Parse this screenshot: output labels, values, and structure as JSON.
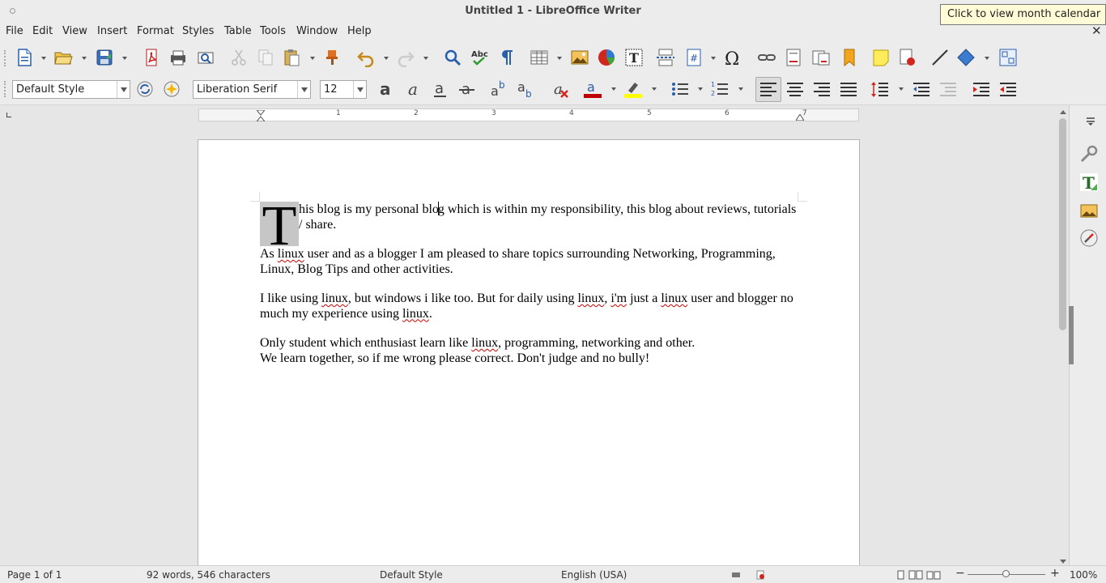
{
  "window": {
    "title": "Untitled 1 - LibreOffice Writer",
    "tooltip": "Click to view month calendar"
  },
  "menu": [
    "File",
    "Edit",
    "View",
    "Insert",
    "Format",
    "Styles",
    "Table",
    "Tools",
    "Window",
    "Help"
  ],
  "formatting": {
    "paragraph_style": "Default Style",
    "font_name": "Liberation Serif",
    "font_size": "12"
  },
  "ruler": {
    "numbers": [
      "1",
      "2",
      "3",
      "4",
      "5",
      "6",
      "7"
    ]
  },
  "document": {
    "dropcap": "T",
    "p1_a": "his blog is my personal blo",
    "p1_b": "g which is within my responsibility, this blog about reviews, tutorials / share.",
    "p2_a": "As ",
    "p2_linux": "linux",
    "p2_b": " user and as a blogger I am pleased to share topics surrounding Networking, Programming, Linux, Blog Tips and other activities.",
    "p3_a": "I like using ",
    "p3_linux1": "linux",
    "p3_b": ", but windows i like too. But for daily using ",
    "p3_linux2": "linux",
    "p3_c": ", ",
    "p3_im": "i'm",
    "p3_d": " just a ",
    "p3_linux3": "linux",
    "p3_e": " user and blogger no much my experience using ",
    "p3_linux4": "linux",
    "p3_f": ".",
    "p4_a": "Only student which enthusiast learn like ",
    "p4_linux": "linux",
    "p4_b": ", programming, networking and other.",
    "p4_line2": "We learn together, so if me wrong please correct. Don't judge and no bully!"
  },
  "status": {
    "page": "Page 1 of 1",
    "words": "92 words, 546 characters",
    "style": "Default Style",
    "language": "English (USA)",
    "zoom": "100%",
    "zoom_percent": 100
  },
  "icons": {
    "toolbar1": [
      "new-document-icon",
      "open-icon",
      "save-icon",
      "export-pdf-icon",
      "print-icon",
      "print-preview-icon",
      "cut-icon",
      "copy-icon",
      "paste-icon",
      "clone-formatting-icon",
      "undo-icon",
      "redo-icon",
      "find-replace-icon",
      "spelling-icon",
      "formatting-marks-icon",
      "insert-table-icon",
      "insert-image-icon",
      "insert-chart-icon",
      "insert-textbox-icon",
      "page-break-icon",
      "field-icon",
      "special-character-icon",
      "hyperlink-icon",
      "footnote-icon",
      "endnote-icon",
      "bookmark-icon",
      "comment-icon",
      "track-changes-icon",
      "line-icon",
      "shapes-icon",
      "form-controls-icon"
    ],
    "sidebar": [
      "sidebar-menu-icon",
      "properties-icon",
      "styles-icon",
      "gallery-icon",
      "navigator-icon"
    ]
  },
  "colors": {
    "font_color": "#c00000",
    "highlight_color": "#ffff00",
    "spellcheck_underline": "#d00000"
  }
}
